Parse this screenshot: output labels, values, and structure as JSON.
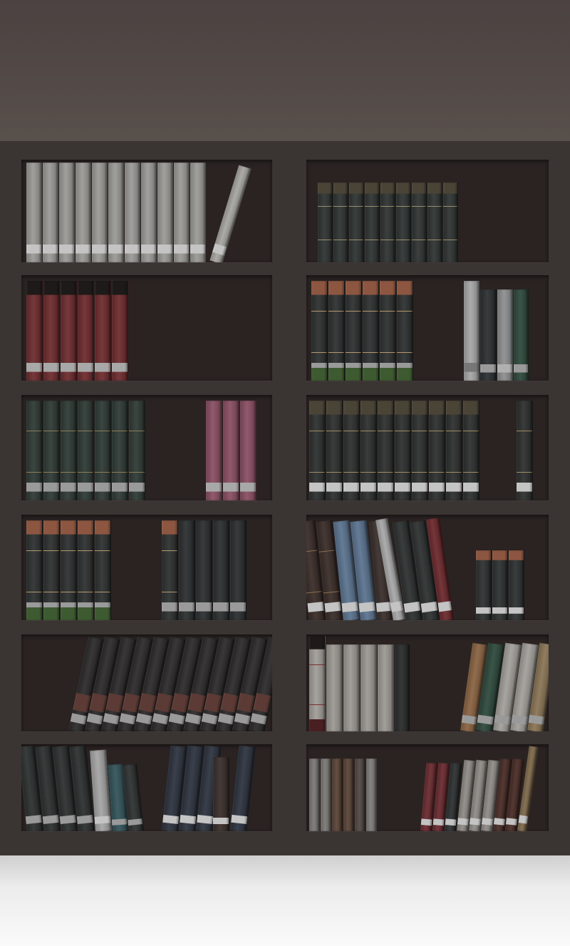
{
  "palette": {
    "wall": "#534a47",
    "case": "#3a3432",
    "cubby": "#2a2322",
    "band_light": "#c9c9c9",
    "floor": "#f2f2f2"
  },
  "shelves": [
    {
      "name": "cubby-left-1",
      "books": [
        {
          "c": "#9b9a96",
          "n": 11,
          "w": 23,
          "h": 140,
          "band": "#c4c4c4"
        },
        {
          "gap": 4
        },
        {
          "c": "#a8a6a1",
          "n": 1,
          "w": 19,
          "h": 140,
          "tilt": 17,
          "band": "#c4c4c4"
        }
      ]
    },
    {
      "name": "cubby-right-1",
      "pad": 16,
      "books": [
        {
          "c": "#2f3433",
          "n": 9,
          "w": 22,
          "h": 112,
          "cap": "#4a4437",
          "stripe": "#9d8f6b"
        }
      ]
    },
    {
      "name": "cubby-left-2",
      "books": [
        {
          "c": "#6e2c2f",
          "n": 6,
          "w": 24,
          "h": 140,
          "cap": "#1e1a19",
          "band": "#a8a8a8"
        }
      ]
    },
    {
      "name": "cubby-right-2",
      "books": [
        {
          "c": "#2e3131",
          "n": 6,
          "w": 24,
          "h": 140,
          "cap": "#8c5641",
          "stripe": "#b59a6e",
          "band": "#9a9a9a",
          "base": "#3d5a30"
        },
        {
          "gap": 70
        },
        {
          "c": "#a7a7a7",
          "n": 1,
          "w": 23,
          "h": 140,
          "band": "#777777"
        },
        {
          "c": "#2c3031",
          "n": 1,
          "w": 24,
          "h": 128,
          "band": "#9a9a9a"
        },
        {
          "c": "#8e8f90",
          "n": 1,
          "w": 23,
          "h": 128,
          "band": "#b0b0b0"
        },
        {
          "c": "#2f4a3d",
          "n": 1,
          "w": 22,
          "h": 128,
          "band": "#9a9a9a"
        }
      ]
    },
    {
      "name": "cubby-left-3",
      "books": [
        {
          "c": "#2f3a35",
          "n": 7,
          "w": 24,
          "h": 140,
          "stripe": "#8f7d58",
          "band": "#9a9a9a"
        },
        {
          "gap": 84
        },
        {
          "c": "#8a4f64",
          "n": 3,
          "w": 24,
          "h": 140,
          "band": "#a8a8a8"
        }
      ]
    },
    {
      "name": "cubby-right-3",
      "pad": 4,
      "books": [
        {
          "c": "#2e3030",
          "n": 10,
          "w": 24,
          "h": 140,
          "cap": "#4a4437",
          "stripe": "#a08f63",
          "band": "#c4c4c4"
        },
        {
          "gap": 51
        },
        {
          "c": "#2e3030",
          "n": 1,
          "w": 24,
          "h": 140,
          "stripe": "#a08f63",
          "band": "#c4c4c4"
        }
      ]
    },
    {
      "name": "cubby-left-4",
      "books": [
        {
          "c": "#2e3131",
          "n": 5,
          "w": 24,
          "h": 140,
          "cap": "#8c5641",
          "stripe": "#b59a6e",
          "band": "#9a9a9a",
          "base": "#3d5a30"
        },
        {
          "gap": 70
        },
        {
          "c": "#2e3131",
          "n": 1,
          "w": 24,
          "h": 140,
          "cap": "#8c5641",
          "stripe": "#b59a6e",
          "band": "#9a9a9a"
        },
        {
          "c": "#2c2f30",
          "n": 4,
          "w": 24,
          "h": 140,
          "band": "#9a9a9a"
        }
      ]
    },
    {
      "name": "cubby-right-4",
      "pad": 4,
      "books": [
        {
          "c": "#3a2d29",
          "n": 2,
          "w": 24,
          "h": 140,
          "tilt": -6,
          "stripe": "#8c7050",
          "band": "#c4c4c4"
        },
        {
          "c": "#5c7490",
          "n": 2,
          "w": 24,
          "h": 140,
          "tilt": -6,
          "band": "#c4c4c4"
        },
        {
          "c": "#3a2f2c",
          "n": 1,
          "w": 22,
          "h": 140,
          "tilt": -5,
          "band": "#c4c4c4"
        },
        {
          "c": "#a8a8a8",
          "n": 1,
          "w": 18,
          "h": 144,
          "tilt": -10,
          "band": "#c4c4c4"
        },
        {
          "c": "#2e3131",
          "n": 2,
          "w": 24,
          "h": 140,
          "tilt": -8,
          "band": "#c4c4c4"
        },
        {
          "c": "#6c2a2e",
          "n": 1,
          "w": 20,
          "h": 144,
          "tilt": -8,
          "band": "#c4c4c4"
        },
        {
          "gap": 30
        },
        {
          "c": "#2e3131",
          "n": 3,
          "w": 23,
          "h": 98,
          "cap": "#8c5641",
          "band": "#c4c4c4"
        },
        {
          "gap": 18
        },
        {
          "c": "#3b3634",
          "n": 1,
          "w": 24,
          "h": 140,
          "band": "#9a9a9a"
        }
      ]
    },
    {
      "name": "cubby-left-5",
      "pad": 66,
      "books": [
        {
          "c": "#2d2b2b",
          "n": 12,
          "w": 23,
          "h": 134,
          "tilt": 12,
          "rust": "#5c3a35",
          "band": "#9a9a9a"
        }
      ]
    },
    {
      "name": "cubby-right-5",
      "pad": 4,
      "books": [
        {
          "c": "#a29d98",
          "n": 1,
          "w": 24,
          "h": 136,
          "cap": "#1f1a19",
          "base": "#4a1f22",
          "stripe": "#7a3030"
        },
        {
          "c": "#9c9893",
          "n": 4,
          "w": 24,
          "h": 122
        },
        {
          "c": "#2a2c2c",
          "n": 1,
          "w": 22,
          "h": 122
        },
        {
          "gap": 70
        },
        {
          "c": "#8a6443",
          "n": 1,
          "w": 22,
          "h": 124,
          "tilt": 8,
          "band": "#9a9a9a"
        },
        {
          "c": "#2f4a3d",
          "n": 1,
          "w": 24,
          "h": 124,
          "tilt": 8,
          "band": "#9a9a9a"
        },
        {
          "c": "#a3a09b",
          "n": 2,
          "w": 24,
          "h": 124,
          "tilt": 8,
          "band": "#9a9a9a"
        },
        {
          "c": "#8a7556",
          "n": 1,
          "w": 23,
          "h": 124,
          "tilt": 8,
          "band": "#9a9a9a"
        }
      ]
    },
    {
      "name": "cubby-right-6",
      "pad": 4,
      "books": [
        {
          "c": "#7b7775",
          "n": 2,
          "w": 16,
          "h": 102
        },
        {
          "c": "#5a4437",
          "n": 2,
          "w": 16,
          "h": 102
        },
        {
          "c": "#514844",
          "n": 1,
          "w": 16,
          "h": 102
        },
        {
          "c": "#7e7b79",
          "n": 1,
          "w": 16,
          "h": 102
        },
        {
          "gap": 60
        },
        {
          "c": "#6a2b30",
          "n": 2,
          "w": 17,
          "h": 96,
          "tilt": 5,
          "band": "#c4c4c4"
        },
        {
          "c": "#2e3131",
          "n": 1,
          "w": 17,
          "h": 96,
          "tilt": 5,
          "band": "#c4c4c4"
        },
        {
          "c": "#8f8c87",
          "n": 3,
          "w": 17,
          "h": 100,
          "tilt": 6,
          "band": "#c4c4c4"
        },
        {
          "c": "#4a2d27",
          "n": 2,
          "w": 17,
          "h": 102,
          "tilt": 6,
          "band": "#c4c4c4"
        },
        {
          "c": "#7f6a4c",
          "n": 1,
          "w": 14,
          "h": 120,
          "tilt": 8,
          "band": "#c4c4c4"
        }
      ]
    },
    {
      "name": "cubby-left-6",
      "pad": 8,
      "books": [
        {
          "c": "#2d3030",
          "n": 4,
          "w": 24,
          "h": 120,
          "tilt": -6,
          "band": "#9a9a9a"
        },
        {
          "c": "#a5a5a5",
          "n": 1,
          "w": 24,
          "h": 114,
          "tilt": -4,
          "band": "#c4c4c4"
        },
        {
          "c": "#33545a",
          "n": 1,
          "w": 23,
          "h": 94,
          "tilt": -4,
          "band": "#9a9a9a"
        },
        {
          "c": "#2f3232",
          "n": 1,
          "w": 22,
          "h": 94,
          "tilt": -6,
          "band": "#9a9a9a"
        },
        {
          "gap": 24
        },
        {
          "c": "#2e3440",
          "n": 3,
          "w": 24,
          "h": 120,
          "tilt": 6,
          "band": "#c4c4c4"
        },
        {
          "c": "#3a2f2c",
          "n": 1,
          "w": 24,
          "h": 104,
          "band": "#c4c4c4"
        },
        {
          "c": "#2e3440",
          "n": 1,
          "w": 24,
          "h": 120,
          "tilt": 6,
          "band": "#c4c4c4"
        }
      ]
    }
  ]
}
